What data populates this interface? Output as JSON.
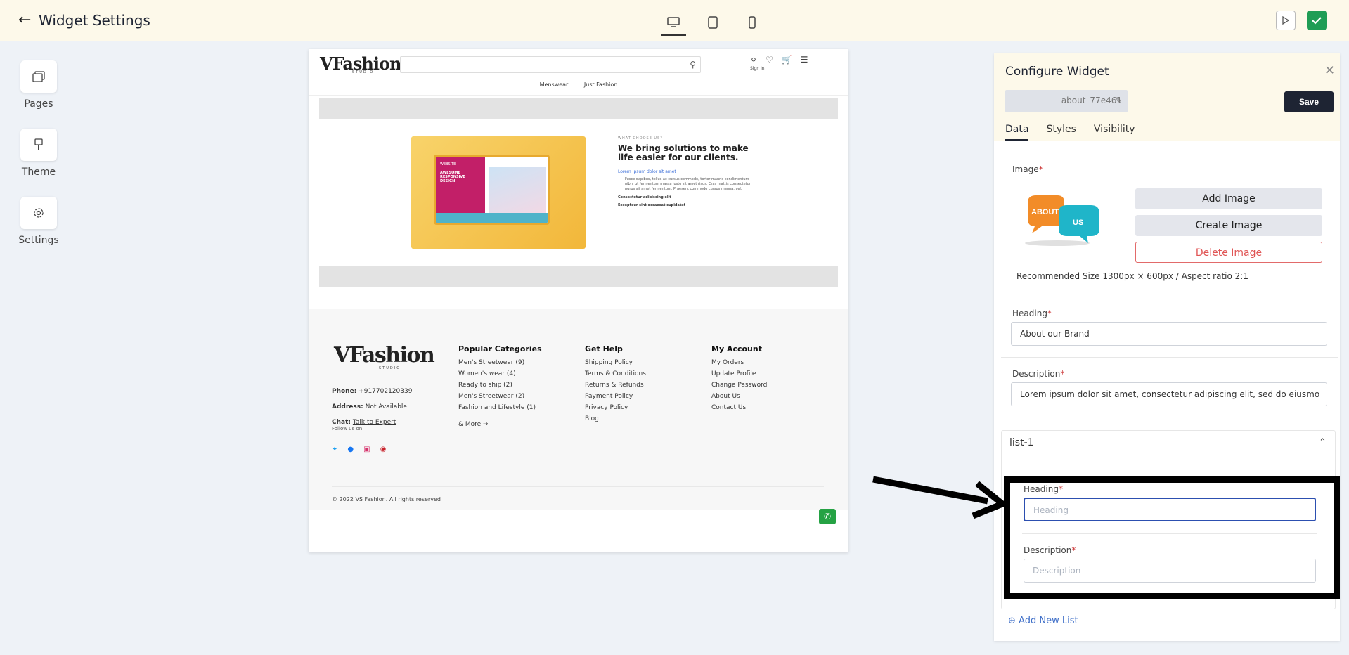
{
  "header": {
    "title": "Widget Settings",
    "devices": [
      "desktop-icon",
      "tablet-icon",
      "mobile-icon"
    ]
  },
  "sidenav": [
    {
      "label": "Pages",
      "icon": "pages-icon"
    },
    {
      "label": "Theme",
      "icon": "brush-icon"
    },
    {
      "label": "Settings",
      "icon": "gear-icon"
    }
  ],
  "store": {
    "nav": [
      "Menswear",
      "Just Fashion"
    ],
    "signin": "Sign In",
    "about": {
      "small": "WHAT CHOOSE US?",
      "heading": "We bring solutions to make life easier for our clients.",
      "link": "Lorem Ipsum dolor sit amet",
      "para": "Fusce dapibus, tellus ac cursus commodo, tortor mauris condimentum nibh, ut fermentum massa justo sit amet risus. Cras mattis consectetur purus sit amet fermentum. Praesent commodo cursus magna, vel.",
      "b1": "Consectetur adipiscing elit",
      "b2": "Excepteur sint occaecat cupidatat"
    },
    "screen": {
      "label": "WEBSITE",
      "line1": "AWESOME",
      "line2": "RESPONSIVE",
      "line3": "DESIGN"
    },
    "footer": {
      "phone_label": "Phone:",
      "phone": "+917702120339",
      "address_label": "Address:",
      "address": "Not Available",
      "chat_label": "Chat:",
      "chat": "Talk to Expert",
      "follow": "Follow us on:",
      "copyright": "© 2022 VS Fashion. All rights reserved",
      "columns": [
        {
          "title": "Popular Categories",
          "items": [
            "Men's Streetwear (9)",
            "Women's wear (4)",
            "Ready to ship (2)",
            "Men's Streetwear (2)",
            "Fashion and Lifestyle (1)"
          ],
          "more": "& More →"
        },
        {
          "title": "Get Help",
          "items": [
            "Shipping Policy",
            "Terms & Conditions",
            "Returns & Refunds",
            "Payment Policy",
            "Privacy Policy",
            "Blog"
          ]
        },
        {
          "title": "My Account",
          "items": [
            "My Orders",
            "Update Profile",
            "Change Password",
            "About Us",
            "Contact Us"
          ]
        }
      ]
    }
  },
  "panel": {
    "title": "Configure Widget",
    "widget_name": "about_77e461",
    "save": "Save",
    "tabs": [
      "Data",
      "Styles",
      "Visibility"
    ],
    "image_label": "Image",
    "image_bubble1": "ABOUT",
    "image_bubble2": "US",
    "add_image": "Add Image",
    "create_image": "Create Image",
    "delete_image": "Delete Image",
    "rec_size": "Recommended Size 1300px × 600px / Aspect ratio 2:1",
    "heading_label": "Heading",
    "heading_value": "About our Brand",
    "desc_label": "Description",
    "desc_value": "Lorem ipsum dolor sit amet, consectetur adipiscing elit, sed do eiusmo",
    "list_title": "list-1",
    "list_heading_label": "Heading",
    "list_heading_placeholder": "Heading",
    "list_desc_label": "Description",
    "list_desc_placeholder": "Description",
    "add_list": "Add New List"
  },
  "colors": {
    "accent": "#1e2433",
    "highlight": "#000000",
    "topbar": "#fdf9ea",
    "delete": "#e05555"
  }
}
